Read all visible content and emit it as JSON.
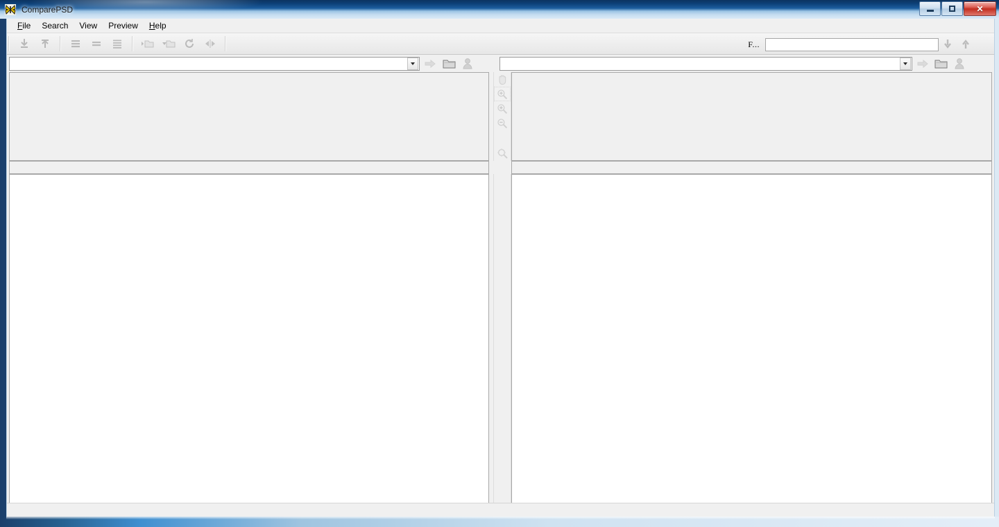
{
  "window": {
    "title": "ComparePSD",
    "icon": "butterfly-icon",
    "minimize_label": "",
    "maximize_label": "",
    "close_label": "✕"
  },
  "menu": {
    "items": [
      {
        "label": "File",
        "accel": "F"
      },
      {
        "label": "Search",
        "accel": ""
      },
      {
        "label": "View",
        "accel": ""
      },
      {
        "label": "Preview",
        "accel": ""
      },
      {
        "label": "Help",
        "accel": "H"
      }
    ]
  },
  "toolbar": {
    "buttons": [
      {
        "name": "collapse-all-icon",
        "enabled": false
      },
      {
        "name": "expand-all-icon",
        "enabled": false
      },
      {
        "name": "view-details-icon",
        "enabled": false
      },
      {
        "name": "view-list-icon",
        "enabled": false
      },
      {
        "name": "view-report-icon",
        "enabled": false
      },
      {
        "name": "open-folder-left-icon",
        "enabled": false
      },
      {
        "name": "open-folder-right-icon",
        "enabled": false
      },
      {
        "name": "refresh-icon",
        "enabled": false
      },
      {
        "name": "swap-sides-icon",
        "enabled": false
      }
    ],
    "find": {
      "label": "F...",
      "value": "",
      "placeholder": "",
      "find_next_label": "",
      "find_prev_label": ""
    }
  },
  "left_panel": {
    "path": {
      "value": "",
      "placeholder": ""
    },
    "go_label": "",
    "browse_label": "",
    "profile_label": "",
    "preview_content": "",
    "info_text": "",
    "list_items": []
  },
  "right_panel": {
    "path": {
      "value": "",
      "placeholder": ""
    },
    "go_label": "",
    "browse_label": "",
    "profile_label": "",
    "preview_content": "",
    "info_text": "",
    "list_items": []
  },
  "preview_tools": [
    {
      "name": "pan-hand-icon",
      "selected": false
    },
    {
      "name": "zoom-selection-icon",
      "selected": true
    },
    {
      "name": "zoom-in-icon",
      "selected": false
    },
    {
      "name": "zoom-out-icon",
      "selected": false
    },
    {
      "name": "zoom-fit-icon",
      "selected": false
    }
  ],
  "statusbar": {
    "text": ""
  },
  "colors": {
    "title_dark": "#0c3461",
    "title_light": "#dbeaf7",
    "close_red": "#c22e20",
    "panel_bg": "#f0f0f0",
    "list_bg": "#ffffff",
    "border": "#a8a8a8"
  }
}
